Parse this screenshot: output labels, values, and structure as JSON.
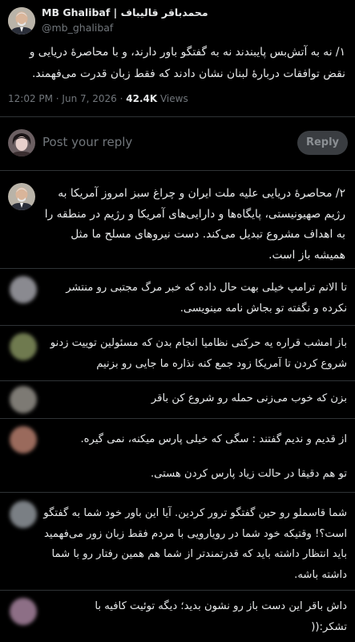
{
  "header": {
    "display_name": "محمدباقر قالیباف | MB Ghalibaf",
    "handle": "@mb_ghalibaf"
  },
  "main_tweet": {
    "text": "۱/ نه به آتش‌بس پایبندند نه به گفتگو باور دارند، و با محاصرهٔ دریایی و نقض توافقات دربارهٔ لبنان نشان دادند که فقط زبان قدرت می‌فهمند.",
    "time": "12:02 PM · Jun 7, 2026 · ",
    "views_count": "42.4K",
    "views_label": " Views"
  },
  "composer": {
    "placeholder": "Post your reply",
    "reply_button": "Reply"
  },
  "thread_tweet": {
    "text": "۲/ محاصرهٔ دریایی علیه ملت ایران و چراغ سبز امروز آمریکا به رژیم صهیونیستی، پایگاه‌ها و دارایی‌های آمریکا و رژیم در منطقه را به اهداف مشروع تبدیل می‌کند. دست نیروهای مسلح ما مثل همیشه باز است."
  },
  "replies": [
    {
      "text": "تا الانم ترامپ خیلی بهت حال داده که خبر مرگ مجتبی رو منتشر نکرده و نگفته تو بجاش نامه مینویسی."
    },
    {
      "text": "باز امشب قراره یه حرکتی نظامیا انجام بدن که مسئولین توییت زدنو شروع کردن تا آمریکا زود جمع کنه نذاره ما جایی رو بزنیم"
    },
    {
      "text": "بزن که خوب می‌زنی حمله رو شروع کن باقر"
    },
    {
      "line1": "از قدیم و ندیم گفتند : سگی که خیلی پارس میکنه، نمی گیره.",
      "line2": "تو هم دقیقا در حالت زیاد پارس کردن هستی."
    },
    {
      "text": "شما قاسملو رو حین گفتگو ترور کردین. آیا این باور خود شما به گفتگو است؟! وقتیکه خود شما در رویارویی با مردم فقط زبان زور می‌فهمید باید انتظار داشته باید که قدرتمندتر از شما هم همین رفتار رو با شما داشته باشه."
    },
    {
      "text": "داش باقر این دست باز رو نشون بدید؛ دیگه توئیت کافیه با تشکر:(("
    }
  ]
}
